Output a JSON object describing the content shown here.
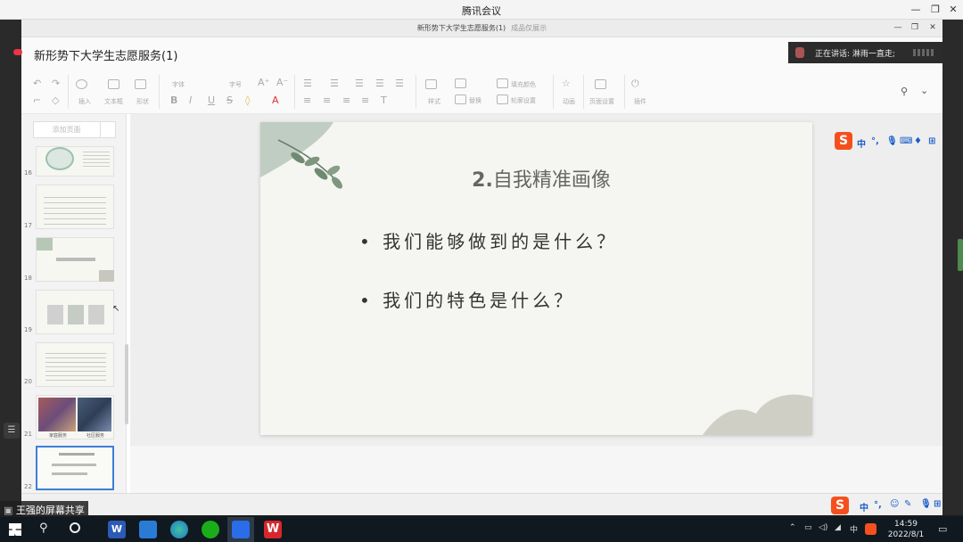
{
  "app": {
    "title": "腾讯会议"
  },
  "wps": {
    "window_title": "新形势下大学生志愿服务(1)",
    "window_subtitle": "成品仅展示",
    "doc_name": "新形势下大学生志愿服务(1)"
  },
  "speaking": {
    "text": "正在讲话: 淋雨一直走;"
  },
  "toolbar": {
    "insert": "插入",
    "textbox": "文本框",
    "shape": "形状",
    "font": "字体",
    "size": "字号",
    "style": "样式",
    "replace": "替换",
    "fill": "填充颜色",
    "outline": "轮廓设置",
    "animation": "动画",
    "page_setup": "页面设置",
    "plugin": "插件"
  },
  "thumbs": {
    "search_label": "添加页面",
    "numbers": [
      "16",
      "17",
      "18",
      "19",
      "20",
      "21",
      "22"
    ],
    "captions": [
      "家庭服务",
      "社区服务"
    ]
  },
  "slide": {
    "title_num": "2.",
    "title_text": "自我精准画像",
    "bullets": [
      "我们能够做到的是什么？",
      "我们的特色是什么？"
    ]
  },
  "ime": {
    "zh": "中",
    "punct": "°,",
    "logo": "S"
  },
  "share": {
    "label": "王强的屏幕共享"
  },
  "taskbar": {
    "time": "14:59",
    "date": "2022/8/1",
    "tray_zh": "中"
  },
  "colors": {
    "slide_leaf": "#9fb3a3",
    "sogou": "#f4501e",
    "taskbar": "#101820"
  }
}
